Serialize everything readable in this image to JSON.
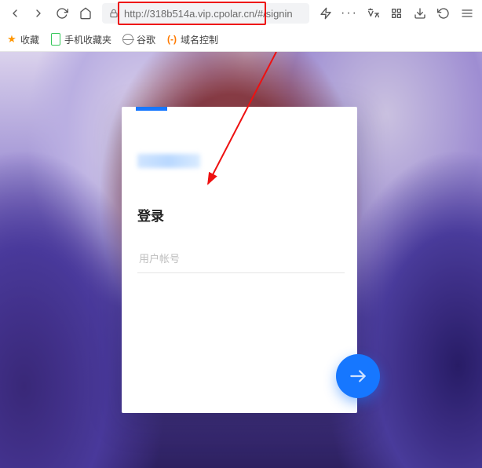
{
  "browser": {
    "url_display": "http://318b514a.vip.cpolar.cn/#/signin",
    "highlight_url_part": "http://318b514a.vip.cpolar.cn"
  },
  "bookmarks": {
    "fav_label": "收藏",
    "mobile_label": "手机收藏夹",
    "google_label": "谷歌",
    "domain_label": "域名控制"
  },
  "login": {
    "title": "登录",
    "username_placeholder": "用户帐号",
    "username_value": ""
  }
}
